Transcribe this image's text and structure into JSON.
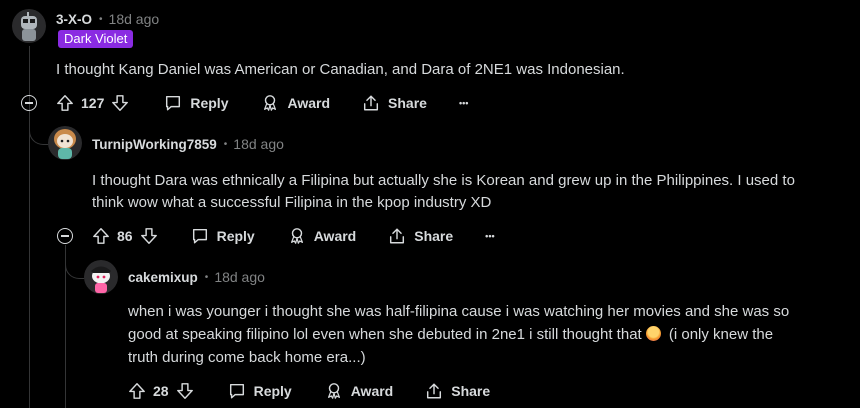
{
  "comments": [
    {
      "username": "3-X-O",
      "time": "18d ago",
      "flair": "Dark Violet",
      "flair_color": "#8a2be2",
      "body": "I thought Kang Daniel was American or Canadian, and Dara of 2NE1 was Indonesian.",
      "votes": "127",
      "avatar_icon": "snoo-robot-avatar-icon"
    },
    {
      "username": "TurnipWorking7859",
      "time": "18d ago",
      "body_line1": "I thought Dara was ethnically a Filipina but actually she is Korean and grew up in the Philippines. I used to",
      "body_line2": "think wow what a successful Filipina in the kpop industry XD",
      "votes": "86",
      "avatar_icon": "snoo-long-hair-avatar-icon"
    },
    {
      "username": "cakemixup",
      "time": "18d ago",
      "body_line1": "when i was younger i thought she was half-filipina cause i was watching her movies and she was so",
      "body_line2a": "good at speaking filipino lol even when she debuted in 2ne1 i still thought that",
      "body_line2b": "(i only knew the",
      "body_line3": "truth during come back home era...)",
      "emoji": "emoji-icon",
      "votes": "28",
      "avatar_icon": "snoo-cap-avatar-icon"
    }
  ],
  "actions": {
    "reply": "Reply",
    "award": "Award",
    "share": "Share",
    "more": "•••"
  },
  "dot": "•"
}
